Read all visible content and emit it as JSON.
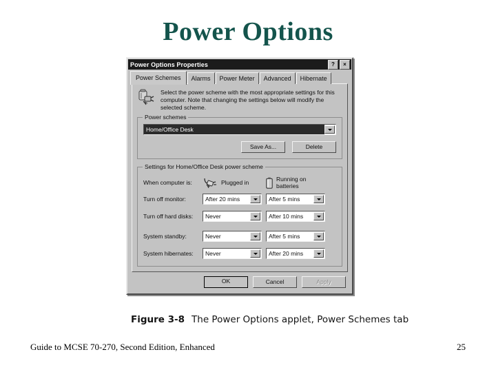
{
  "slide": {
    "title": "Power Options",
    "title_color": "#14544c"
  },
  "dialog": {
    "title": "Power Options Properties",
    "titlebar_color": "#1b1b1b",
    "face_color": "#c3c3c3",
    "help_button": "?",
    "close_button": "×",
    "tabs": [
      {
        "label": "Power Schemes",
        "active": true
      },
      {
        "label": "Alarms",
        "active": false
      },
      {
        "label": "Power Meter",
        "active": false
      },
      {
        "label": "Advanced",
        "active": false
      },
      {
        "label": "Hibernate",
        "active": false
      }
    ],
    "info": {
      "icon": "power-plug-icon",
      "text": "Select the power scheme with the most appropriate settings for this computer. Note that changing the settings below will modify the selected scheme."
    },
    "power_schemes": {
      "group_title": "Power schemes",
      "selected_scheme": "Home/Office Desk",
      "save_as_label": "Save As...",
      "delete_label": "Delete"
    },
    "settings": {
      "group_title": "Settings for Home/Office Desk power scheme",
      "when_computer_is_label": "When computer is:",
      "columns": [
        {
          "icon": "plug-icon",
          "label": "Plugged in"
        },
        {
          "icon": "battery-icon",
          "label": "Running on batteries"
        }
      ],
      "rows": [
        {
          "label": "Turn off monitor:",
          "plugged_in": "After 20 mins",
          "batteries": "After 5 mins"
        },
        {
          "label": "Turn off hard disks:",
          "plugged_in": "Never",
          "batteries": "After 10 mins"
        },
        {
          "label": "System standby:",
          "plugged_in": "Never",
          "batteries": "After 5 mins"
        },
        {
          "label": "System hibernates:",
          "plugged_in": "Never",
          "batteries": "After 20 mins"
        }
      ]
    },
    "buttons": {
      "ok": "OK",
      "cancel": "Cancel",
      "apply": "Apply",
      "apply_disabled": true
    }
  },
  "caption": {
    "figure_number": "Figure 3-8",
    "text": "The Power Options applet, Power Schemes tab"
  },
  "footer": {
    "book": "Guide to MCSE 70-270, Second Edition, Enhanced",
    "page": "25"
  }
}
